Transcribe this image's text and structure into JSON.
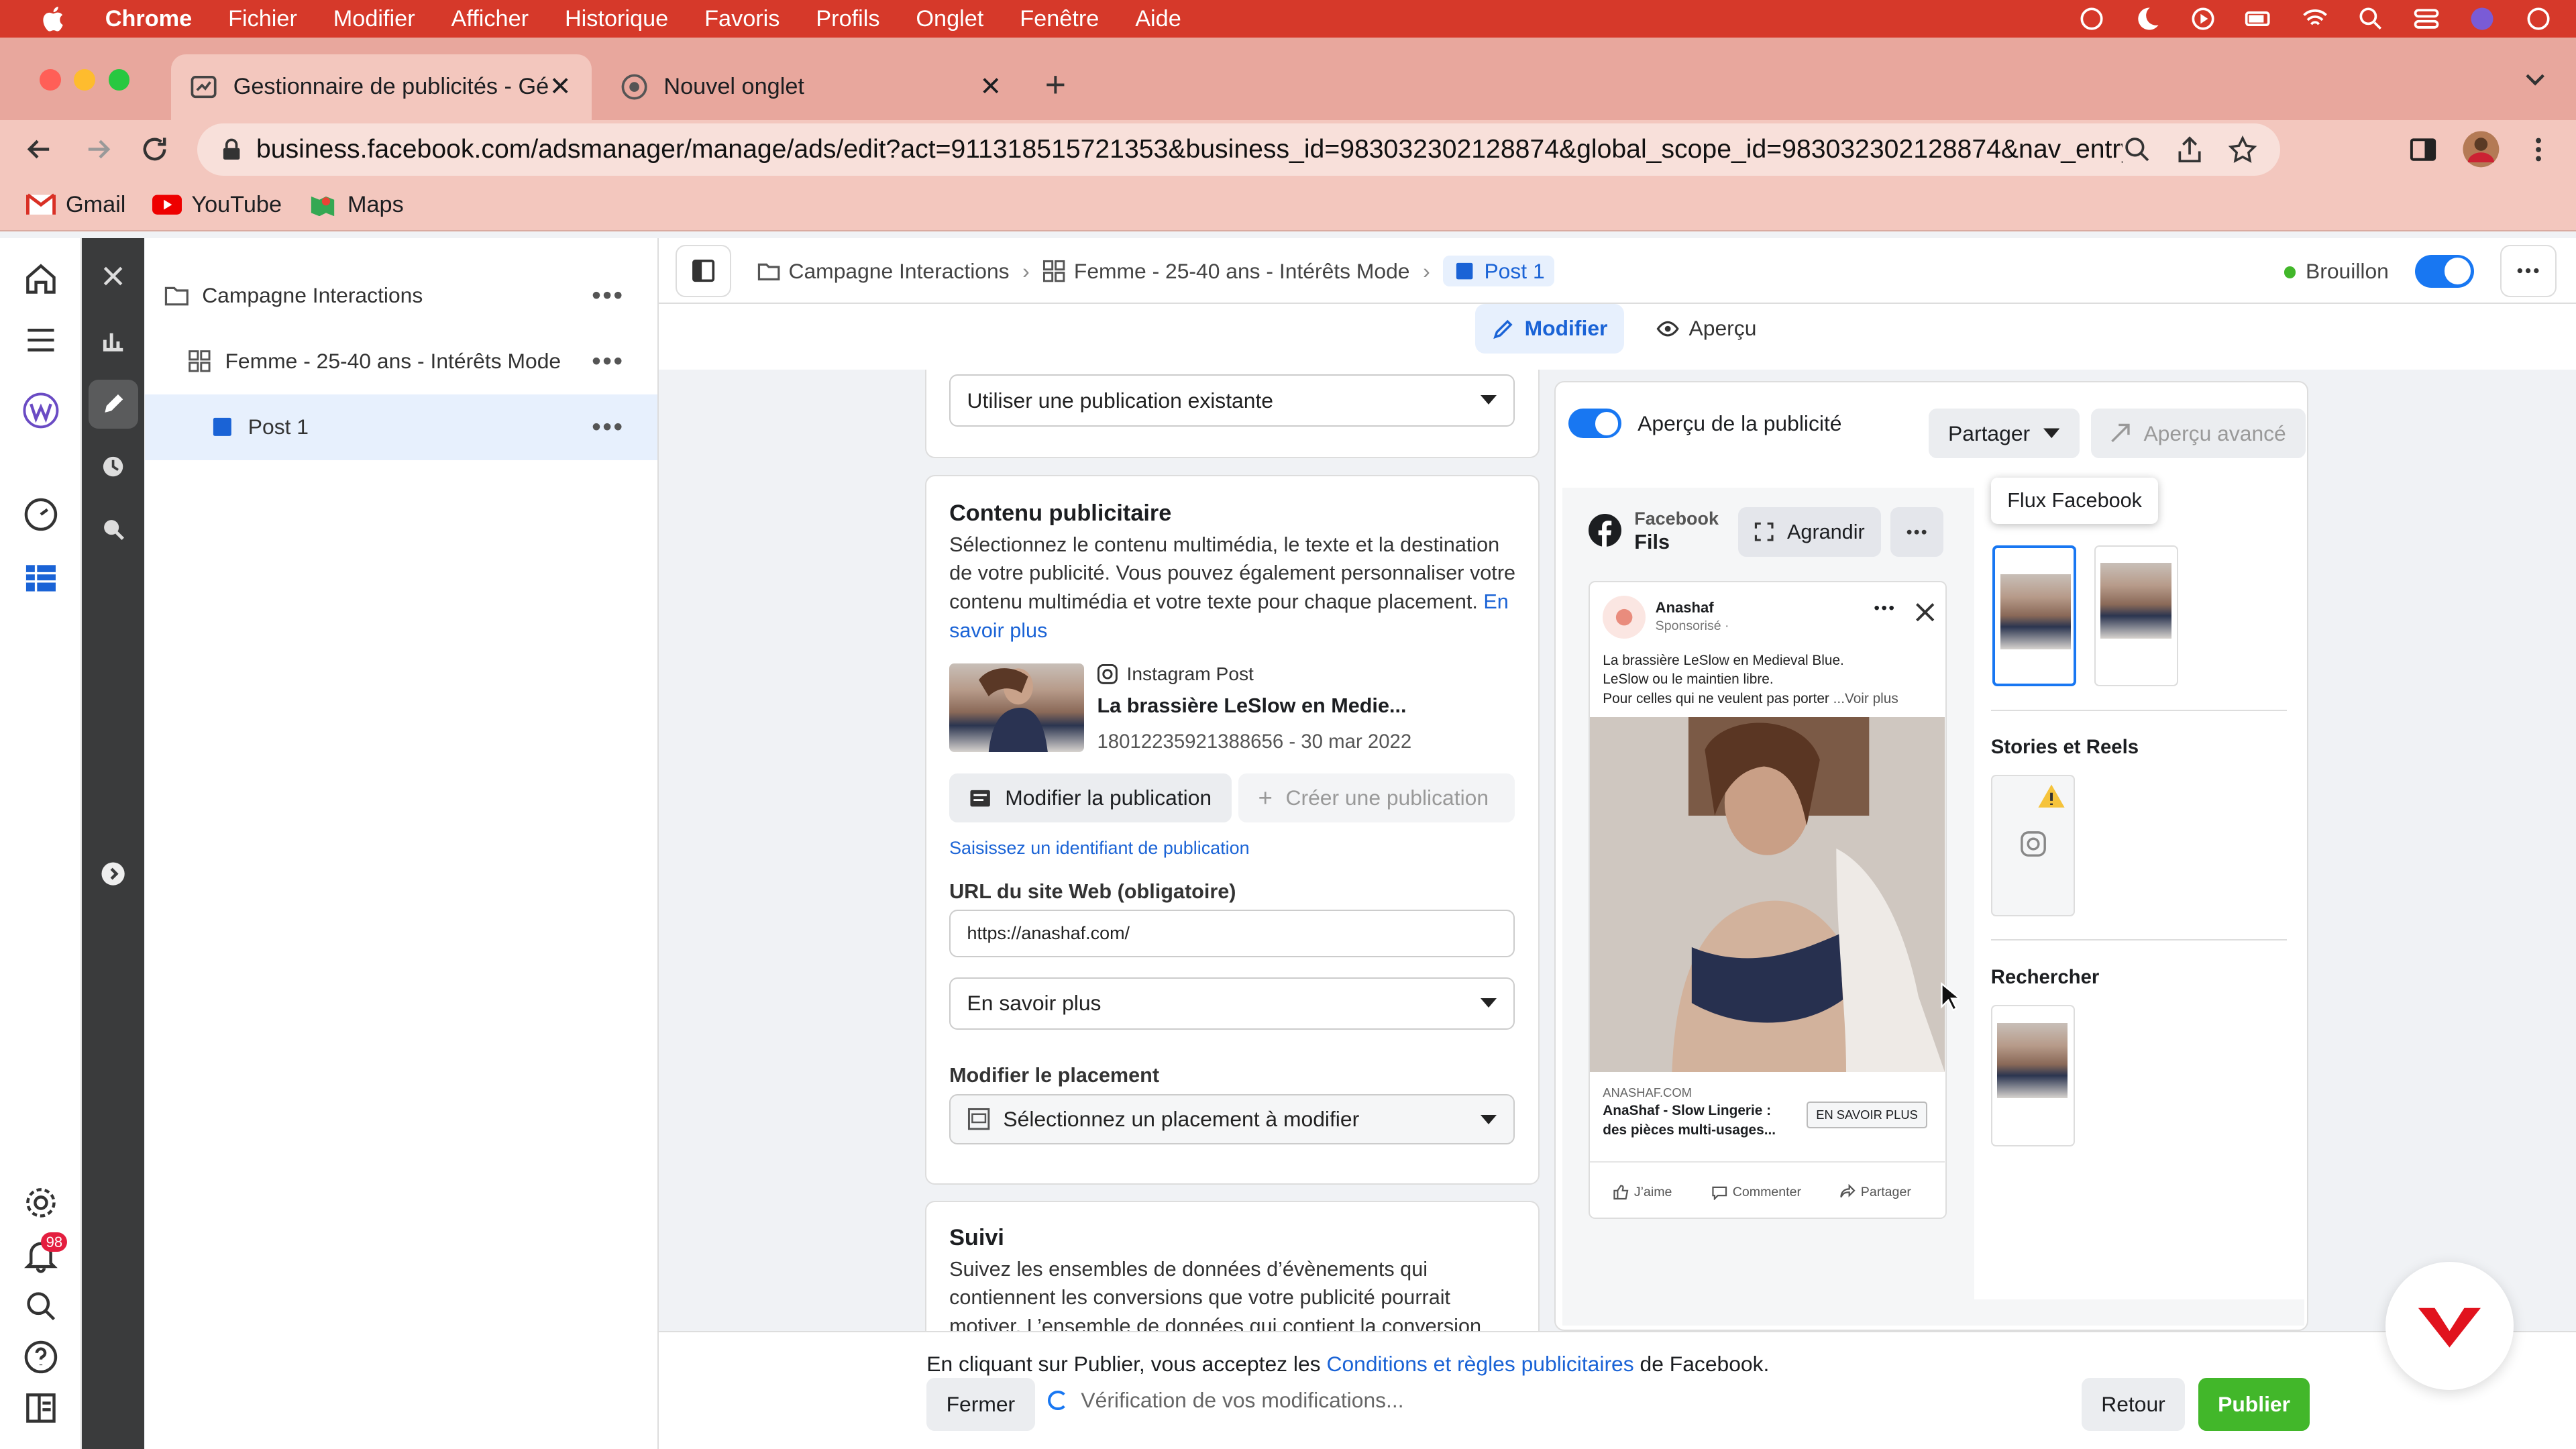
{
  "menubar": {
    "app": "Chrome",
    "items": [
      "Fichier",
      "Modifier",
      "Afficher",
      "Historique",
      "Favoris",
      "Profils",
      "Onglet",
      "Fenêtre",
      "Aide"
    ]
  },
  "tabs": [
    {
      "title": "Gestionnaire de publicités - Gé",
      "active": true
    },
    {
      "title": "Nouvel onglet",
      "active": false
    }
  ],
  "address": {
    "url": "business.facebook.com/adsmanager/manage/ads/edit?act=911318515721353&business_id=983032302128874&global_scope_id=983032302128874&nav_entry_..."
  },
  "bookmarks": [
    "Gmail",
    "YouTube",
    "Maps"
  ],
  "rail": {
    "notifications_badge": "98"
  },
  "tree": {
    "campaign": "Campagne Interactions",
    "adset": "Femme - 25-40 ans - Intérêts Mode",
    "ad": "Post 1"
  },
  "breadcrumb": {
    "campaign": "Campagne Interactions",
    "adset": "Femme - 25-40 ans - Intérêts Mode",
    "ad": "Post 1"
  },
  "header": {
    "status": "Brouillon"
  },
  "subtabs": {
    "edit": "Modifier",
    "preview": "Aperçu"
  },
  "form": {
    "existing_post_select": "Utiliser une publication existante",
    "ad_content": {
      "title": "Contenu publicitaire",
      "description": "Sélectionnez le contenu multimédia, le texte et la destination de votre publicité. Vous pouvez également personnaliser votre contenu multimédia et votre texte pour chaque placement.",
      "learn_more": "En savoir plus",
      "post": {
        "source": "Instagram Post",
        "title": "La brassière LeSlow en Medie...",
        "meta": "18012235921388656 - 30 mar 2022"
      },
      "edit_post_button": "Modifier la publication",
      "create_post_button": "Créer une publication",
      "enter_id_link": "Saisissez un identifiant de publication",
      "url_label": "URL du site Web (obligatoire)",
      "url_value": "https://anashaf.com/",
      "cta_select": "En savoir plus",
      "placement_label": "Modifier le placement",
      "placement_select": "Sélectionnez un placement à modifier"
    },
    "tracking": {
      "title": "Suivi",
      "description": "Suivez les ensembles de données d’évènements qui contiennent les conversions que votre publicité pourrait motiver. L’ensemble de données qui contient la conversion"
    }
  },
  "preview": {
    "toggle_label": "Aperçu de la publicité",
    "share_button": "Partager",
    "advanced_button": "Aperçu avancé",
    "placement_line1": "Facebook",
    "placement_line2": "Fils",
    "enlarge_button": "Agrandir",
    "tooltip": "Flux Facebook",
    "fb_post": {
      "page": "Anashaf",
      "sponsored": "Sponsorisé ·",
      "text1": "La brassière LeSlow en Medieval Blue.",
      "text2": "LeSlow ou le maintien libre.",
      "text3": "Pour celles qui ne veulent pas porter",
      "see_more": "...Voir plus",
      "domain": "ANASHAF.COM",
      "headline1": "AnaShaf - Slow Lingerie :",
      "headline2": "des pièces multi-usages...",
      "cta": "EN SAVOIR PLUS",
      "like": "J’aime",
      "comment": "Commenter",
      "share": "Partager"
    },
    "sections": {
      "stories": "Stories et Reels",
      "search": "Rechercher"
    }
  },
  "footer": {
    "legal_prefix": "En cliquant sur Publier, vous acceptez les",
    "legal_link": "Conditions et règles publicitaires",
    "legal_suffix": "de Facebook.",
    "close_button": "Fermer",
    "verifying": "Vérification de vos modifications...",
    "back_button": "Retour",
    "publish_button": "Publier"
  },
  "colors": {
    "accent": "#1877f2",
    "publish": "#42b72a",
    "menubar": "#d6392a",
    "tabbar": "#e8a79d"
  }
}
